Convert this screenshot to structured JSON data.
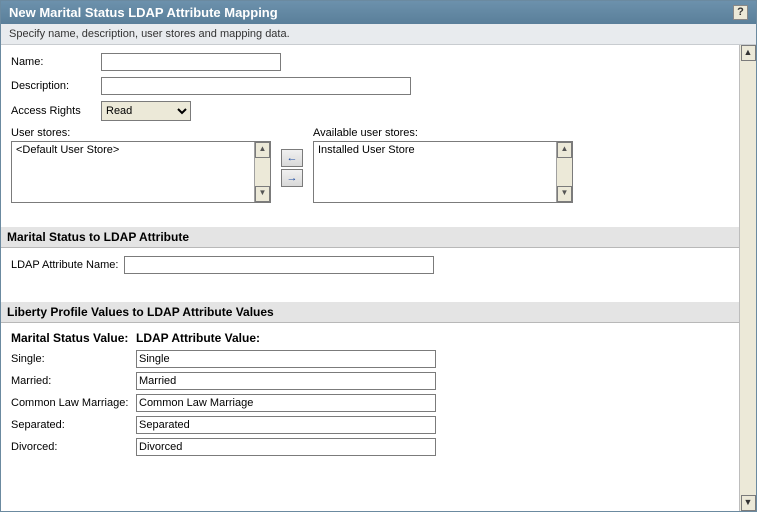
{
  "title": "New Marital Status LDAP Attribute Mapping",
  "subtitle": "Specify name, description, user stores and mapping data.",
  "form": {
    "name_label": "Name:",
    "name_value": "",
    "desc_label": "Description:",
    "desc_value": "",
    "access_label": "Access Rights",
    "access_value": "Read"
  },
  "user_stores": {
    "selected_label": "User stores:",
    "selected_item": "<Default User Store>",
    "available_label": "Available user stores:",
    "available_item": "Installed User Store"
  },
  "section_ldap": {
    "header": "Marital Status to LDAP Attribute",
    "attr_label": "LDAP Attribute Name:",
    "attr_value": ""
  },
  "section_map": {
    "header": "Liberty Profile Values to LDAP Attribute Values",
    "col1": "Marital Status Value:",
    "col2": "LDAP Attribute Value:",
    "rows": [
      {
        "label": "Single:",
        "value": "Single"
      },
      {
        "label": "Married:",
        "value": "Married"
      },
      {
        "label": "Common Law Marriage:",
        "value": "Common Law Marriage"
      },
      {
        "label": "Separated:",
        "value": "Separated"
      },
      {
        "label": "Divorced:",
        "value": "Divorced"
      }
    ]
  }
}
